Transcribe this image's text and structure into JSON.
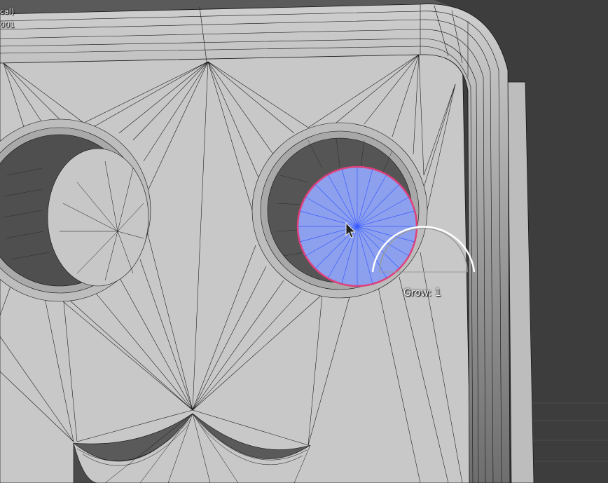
{
  "viewport": {
    "header_line1": "cal)",
    "header_line2": "001"
  },
  "operator": {
    "label": "Grow: 1"
  },
  "colors": {
    "background": "#3d3d3d",
    "mesh_face": "#c9c9c9",
    "wire": "#111111",
    "selection_fill": "#8a9ef0",
    "selection_wire": "#3a5cff",
    "selection_border": "#e0407a"
  }
}
